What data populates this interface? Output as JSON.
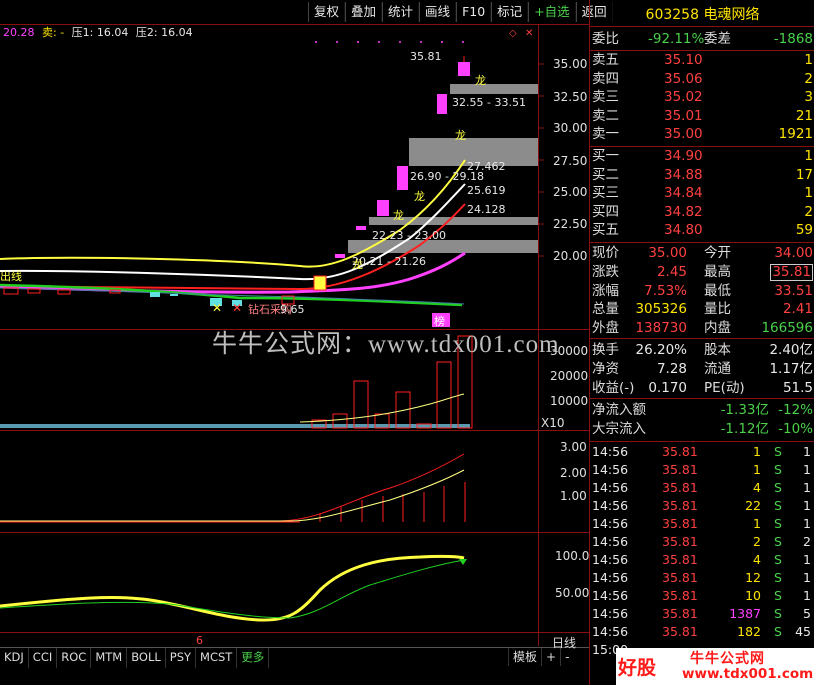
{
  "toolbar": {
    "buttons": [
      "复权",
      "叠加",
      "统计",
      "画线",
      "F10",
      "标记",
      "+自选",
      "返回"
    ]
  },
  "indicator_row": {
    "value": "20.28",
    "sell_label": "卖: -",
    "pressure1": "压1: 16.04",
    "pressure2": "压2: 16.04"
  },
  "chart": {
    "price_axis": [
      "35.00",
      "32.50",
      "30.00",
      "27.50",
      "25.00",
      "22.50",
      "20.00"
    ],
    "volume_axis": [
      "30000",
      "20000",
      "10000"
    ],
    "volume_multiplier": "X10",
    "macd_axis": [
      "3.00",
      "2.00",
      "1.00"
    ],
    "osc_axis": [
      "100.0",
      "50.00"
    ],
    "annotations": {
      "high_price": "35.81",
      "range1": "32.55 - 33.51",
      "ma1": "27.462",
      "range2": "26.90 - 29.18",
      "ma2": "25.619",
      "ma3": "24.128",
      "range3": "22.23 - 23.00",
      "range4": "20.21 - 21.26",
      "dragon": "龙",
      "left_label": "出线",
      "bottom_note": "钻石采购",
      "bottom_price": "9.65",
      "rank_label": "榜",
      "x_marker": "6"
    },
    "colors": {
      "up": "#ff2020",
      "yellow": "#ffff40",
      "white": "#ffffff",
      "magenta": "#ff40ff",
      "green": "#20d020",
      "box": "#808080"
    }
  },
  "watermark": "牛牛公式网：www.tdx001.com",
  "tabs": [
    "KDJ",
    "CCI",
    "ROC",
    "MTM",
    "BOLL",
    "PSY",
    "MCST",
    "更多"
  ],
  "tabs_right": [
    "模板",
    "+",
    "-"
  ],
  "period": "日线",
  "panel": {
    "code": "603258",
    "name": "电魂网络",
    "weibi": {
      "label": "委比",
      "value": "-92.11%",
      "label2": "委差",
      "value2": "-1868"
    },
    "asks": [
      {
        "label": "卖五",
        "price": "35.10",
        "vol": "1"
      },
      {
        "label": "卖四",
        "price": "35.06",
        "vol": "2"
      },
      {
        "label": "卖三",
        "price": "35.02",
        "vol": "3"
      },
      {
        "label": "卖二",
        "price": "35.01",
        "vol": "21"
      },
      {
        "label": "卖一",
        "price": "35.00",
        "vol": "1921"
      }
    ],
    "bids": [
      {
        "label": "买一",
        "price": "34.90",
        "vol": "1"
      },
      {
        "label": "买二",
        "price": "34.88",
        "vol": "17"
      },
      {
        "label": "买三",
        "price": "34.84",
        "vol": "1"
      },
      {
        "label": "买四",
        "price": "34.82",
        "vol": "2"
      },
      {
        "label": "买五",
        "price": "34.80",
        "vol": "59"
      }
    ],
    "stats": [
      {
        "l1": "现价",
        "v1": "35.00",
        "l2": "今开",
        "v2": "34.00"
      },
      {
        "l1": "涨跌",
        "v1": "2.45",
        "l2": "最高",
        "v2": "35.81"
      },
      {
        "l1": "涨幅",
        "v1": "7.53%",
        "l2": "最低",
        "v2": "33.51"
      },
      {
        "l1": "总量",
        "v1": "305326",
        "l2": "量比",
        "v2": "2.41"
      },
      {
        "l1": "外盘",
        "v1": "138730",
        "l2": "内盘",
        "v2": "166596"
      }
    ],
    "fin": [
      {
        "l1": "换手",
        "v1": "26.20%",
        "l2": "股本",
        "v2": "2.40亿"
      },
      {
        "l1": "净资",
        "v1": "7.28",
        "l2": "流通",
        "v2": "1.17亿"
      },
      {
        "l1": "收益(-)",
        "v1": "0.170",
        "l2": "PE(动)",
        "v2": "51.5"
      }
    ],
    "flows": [
      {
        "label": "净流入额",
        "value": "-1.33亿",
        "pct": "-12%"
      },
      {
        "label": "大宗流入",
        "value": "-1.12亿",
        "pct": "-10%"
      }
    ],
    "trades": [
      {
        "time": "14:56",
        "price": "35.81",
        "vol": "1",
        "side": "S",
        "n": "1"
      },
      {
        "time": "14:56",
        "price": "35.81",
        "vol": "1",
        "side": "S",
        "n": "1"
      },
      {
        "time": "14:56",
        "price": "35.81",
        "vol": "4",
        "side": "S",
        "n": "1"
      },
      {
        "time": "14:56",
        "price": "35.81",
        "vol": "22",
        "side": "S",
        "n": "1"
      },
      {
        "time": "14:56",
        "price": "35.81",
        "vol": "1",
        "side": "S",
        "n": "1"
      },
      {
        "time": "14:56",
        "price": "35.81",
        "vol": "2",
        "side": "S",
        "n": "2"
      },
      {
        "time": "14:56",
        "price": "35.81",
        "vol": "4",
        "side": "S",
        "n": "1"
      },
      {
        "time": "14:56",
        "price": "35.81",
        "vol": "12",
        "side": "S",
        "n": "1"
      },
      {
        "time": "14:56",
        "price": "35.81",
        "vol": "10",
        "side": "S",
        "n": "1"
      },
      {
        "time": "14:56",
        "price": "35.81",
        "vol": "1387",
        "side": "S",
        "n": "5"
      },
      {
        "time": "14:56",
        "price": "35.81",
        "vol": "182",
        "side": "S",
        "n": "45"
      },
      {
        "time": "15:00",
        "price": "",
        "vol": "",
        "side": "",
        "n": ""
      }
    ],
    "logo": {
      "t1": "好股",
      "t2": "牛牛公式网",
      "t3": "www.tdx001.com"
    }
  }
}
